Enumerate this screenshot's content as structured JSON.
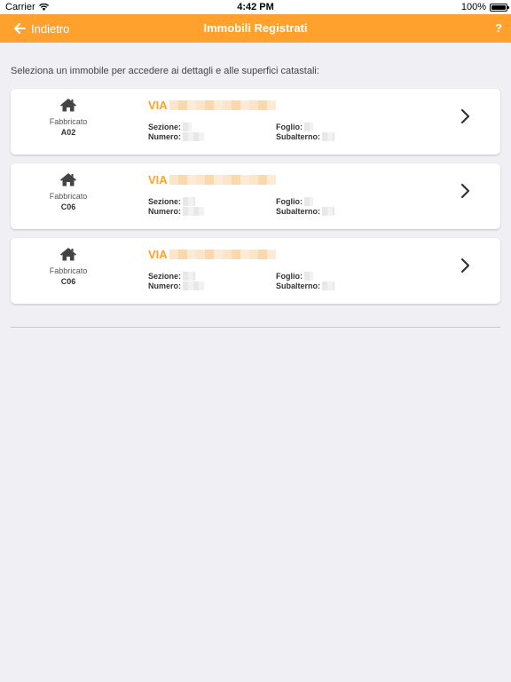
{
  "status_bar": {
    "carrier": "Carrier",
    "time": "4:42 PM",
    "battery": "100%"
  },
  "nav": {
    "back_label": "Indietro",
    "title": "Immobili Registrati",
    "help_label": "?"
  },
  "intro": "Seleziona un immobile per accedere ai dettagli e alle superfici catastali:",
  "colors": {
    "accent": "#ffa12c",
    "background": "#efeff4"
  },
  "properties": [
    {
      "type_label": "Fabbricato",
      "category": "A02",
      "address_prefix": "VIA",
      "sezione_label": "Sezione:",
      "numero_label": "Numero:",
      "foglio_label": "Foglio:",
      "subalterno_label": "Subalterno:"
    },
    {
      "type_label": "Fabbricato",
      "category": "C06",
      "address_prefix": "VIA",
      "sezione_label": "Sezione:",
      "numero_label": "Numero:",
      "foglio_label": "Foglio:",
      "subalterno_label": "Subalterno:"
    },
    {
      "type_label": "Fabbricato",
      "category": "C06",
      "address_prefix": "VIA",
      "sezione_label": "Sezione:",
      "numero_label": "Numero:",
      "foglio_label": "Foglio:",
      "subalterno_label": "Subalterno:"
    }
  ]
}
